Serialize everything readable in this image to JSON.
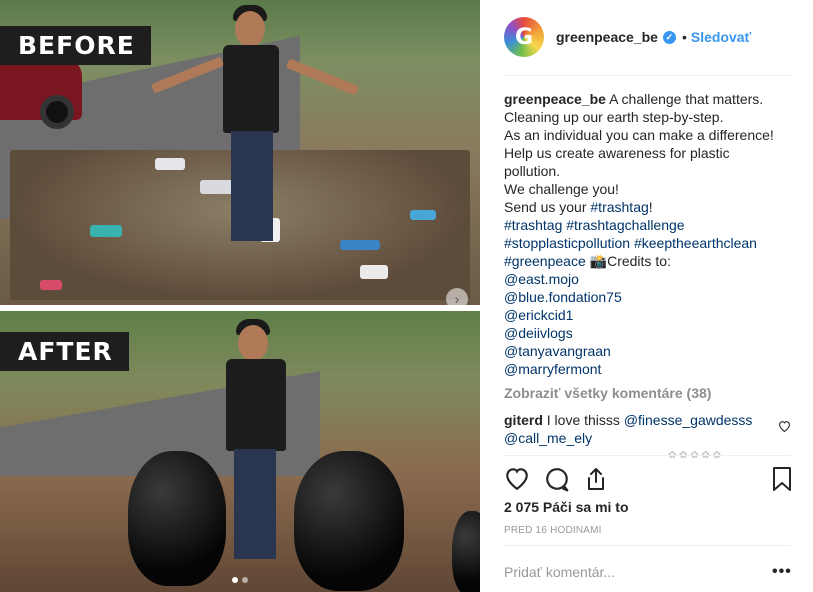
{
  "media": {
    "before_label": "BEFORE",
    "after_label": "AFTER",
    "carousel_next_icon": "chevron-right-icon",
    "carousel": {
      "current": 1,
      "total": 2
    }
  },
  "header": {
    "username": "greenpeace_be",
    "verified_icon": "verified-badge-icon",
    "separator": "•",
    "follow_label": "Sledovať",
    "avatar_letter": "G"
  },
  "caption": {
    "username": "greenpeace_be",
    "lines": [
      "A challenge that matters.",
      "Cleaning up our earth step-by-step.",
      "As an individual you can make a difference!",
      "Help us create awareness for plastic",
      "pollution.",
      "We challenge you!"
    ],
    "send_prefix": "Send us your ",
    "send_tag": "#trashtag",
    "send_suffix": "!",
    "hashtags": [
      "#trashtag #trashtagchallenge",
      "#stopplasticpollution #keeptheearthclean"
    ],
    "greenpeace_tag": "#greenpeace",
    "camera_emoji": "📸",
    "credits_text": "Credits to:",
    "credits": [
      "@east.mojo",
      "@blue.fondation75",
      "@erickcid1",
      "@deiivlogs",
      "@tanyavangraan",
      "@marryfermont"
    ]
  },
  "comments": {
    "view_all": "Zobraziť všetky komentáre (38)",
    "items": [
      {
        "user": "giterd",
        "text": "I love thisss ",
        "mention1": "@finesse_gawdesss",
        "mention2": "@call_me_ely"
      }
    ]
  },
  "actions": {
    "like_icon": "heart-icon",
    "comment_icon": "comment-bubble-icon",
    "share_icon": "share-icon",
    "save_icon": "bookmark-icon"
  },
  "likes_text": "2 075 Páči sa mi to",
  "timestamp": "PRED 16 HODINAMI",
  "add_comment_placeholder": "Pridať komentár...",
  "more_label": "•••",
  "colors": {
    "link": "#003569",
    "follow": "#3897f0",
    "muted": "#8e8e8e"
  }
}
